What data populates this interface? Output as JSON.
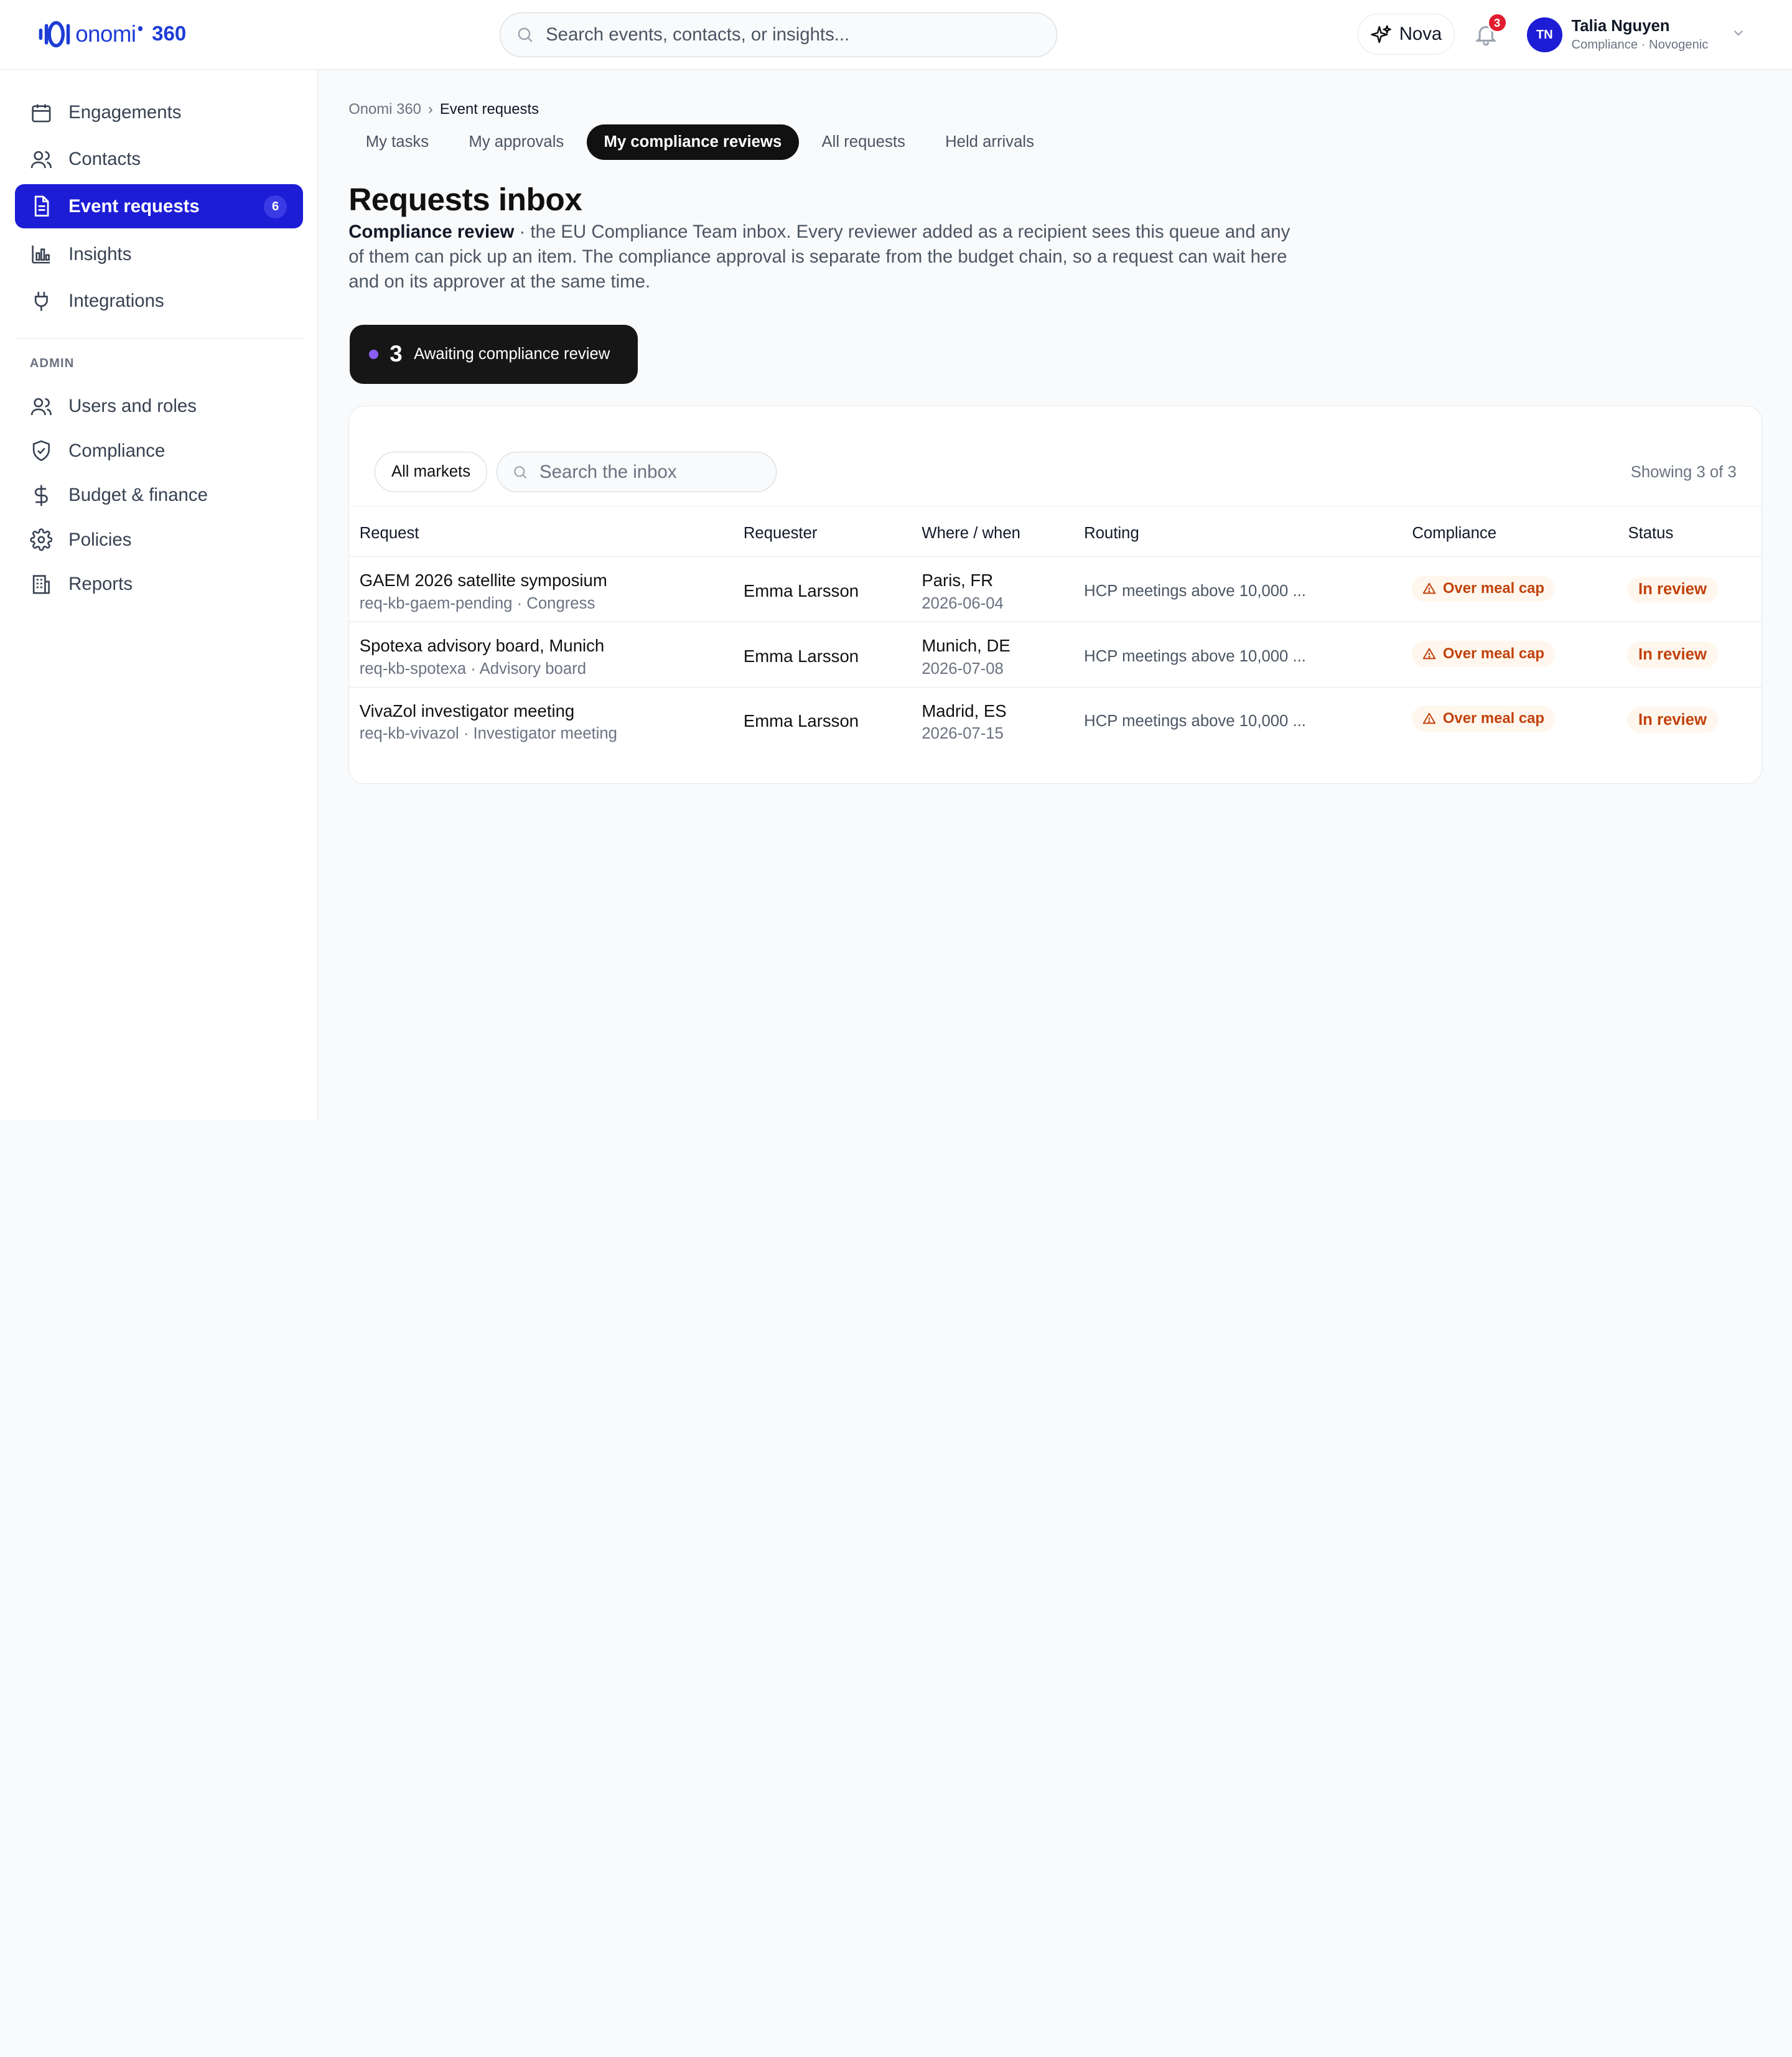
{
  "header": {
    "logo_text": "onomi",
    "logo_suffix": "360",
    "search_placeholder": "Search events, contacts, or insights...",
    "nova_label": "Nova",
    "notification_count": "3",
    "user": {
      "initials": "TN",
      "name": "Talia Nguyen",
      "role": "Compliance · Novogenic"
    }
  },
  "sidebar": {
    "items": [
      {
        "label": "Engagements",
        "icon": "calendar-icon"
      },
      {
        "label": "Contacts",
        "icon": "users-icon"
      },
      {
        "label": "Event requests",
        "icon": "document-icon",
        "count": "6",
        "active": true
      },
      {
        "label": "Insights",
        "icon": "bar-chart-icon"
      },
      {
        "label": "Integrations",
        "icon": "plug-icon"
      }
    ],
    "admin_section_label": "ADMIN",
    "admin_items": [
      {
        "label": "Users and roles",
        "icon": "users-icon"
      },
      {
        "label": "Compliance",
        "icon": "shield-check-icon"
      },
      {
        "label": "Budget & finance",
        "icon": "dollar-icon"
      },
      {
        "label": "Policies",
        "icon": "gear-icon"
      },
      {
        "label": "Reports",
        "icon": "building-icon"
      }
    ]
  },
  "breadcrumb": {
    "root": "Onomi 360",
    "separator": "›",
    "current": "Event requests"
  },
  "tabs": [
    {
      "label": "My tasks"
    },
    {
      "label": "My approvals"
    },
    {
      "label": "My compliance reviews",
      "active": true
    },
    {
      "label": "All requests"
    },
    {
      "label": "Held arrivals"
    }
  ],
  "page": {
    "title": "Requests inbox",
    "desc_strong": "Compliance review",
    "desc_rest": " · the EU Compliance Team inbox. Every reviewer added as a recipient sees this queue and any of them can pick up an item. The compliance approval is separate from the budget chain, so a request can wait here and on its approver at the same time."
  },
  "stat": {
    "count": "3",
    "label": "Awaiting compliance review",
    "dot_color": "#8b5cf6"
  },
  "inbox": {
    "filter_label": "All markets",
    "search_placeholder": "Search the inbox",
    "showing": "Showing 3 of 3",
    "columns": [
      "Request",
      "Requester",
      "Where / when",
      "Routing",
      "Compliance",
      "Status"
    ],
    "rows": [
      {
        "title": "GAEM 2026 satellite symposium",
        "sub": "req-kb-gaem-pending · Congress",
        "requester": "Emma Larsson",
        "place": "Paris, FR",
        "date": "2026-06-04",
        "routing": "HCP meetings above 10,000 ...",
        "compliance": "Over meal cap",
        "status": "In review"
      },
      {
        "title": "Spotexa advisory board, Munich",
        "sub": "req-kb-spotexa · Advisory board",
        "requester": "Emma Larsson",
        "place": "Munich, DE",
        "date": "2026-07-08",
        "routing": "HCP meetings above 10,000 ...",
        "compliance": "Over meal cap",
        "status": "In review"
      },
      {
        "title": "VivaZol investigator meeting",
        "sub": "req-kb-vivazol · Investigator meeting",
        "requester": "Emma Larsson",
        "place": "Madrid, ES",
        "date": "2026-07-15",
        "routing": "HCP meetings above 10,000 ...",
        "compliance": "Over meal cap",
        "status": "In review"
      }
    ]
  },
  "colors": {
    "brand": "#1d1dd6",
    "warn": "#c2410c",
    "warn_bg": "#fff7ed"
  }
}
